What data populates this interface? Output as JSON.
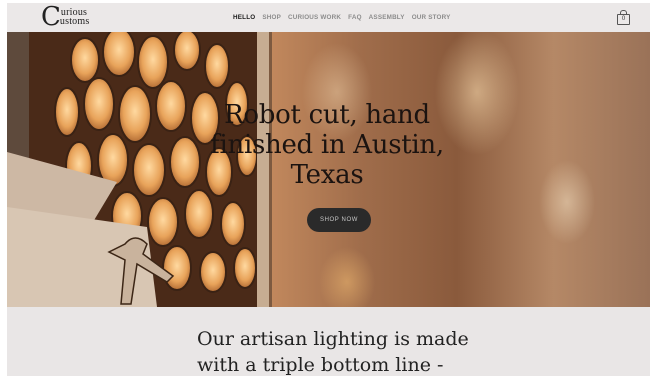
{
  "brand": {
    "logo_initial": "C",
    "logo_line1": "urious",
    "logo_line2": "ustoms"
  },
  "nav": {
    "items": [
      {
        "label": "HELLO",
        "active": true
      },
      {
        "label": "SHOP",
        "active": false
      },
      {
        "label": "CURIOUS WORK",
        "active": false
      },
      {
        "label": "FAQ",
        "active": false
      },
      {
        "label": "ASSEMBLY",
        "active": false
      },
      {
        "label": "OUR STORY",
        "active": false
      }
    ]
  },
  "cart": {
    "count": "0",
    "icon": "shopping-bag-icon"
  },
  "hero": {
    "title_line1": "Robot cut, hand",
    "title_line2": "finished in Austin,",
    "title_line3": "Texas",
    "cta_label": "SHOP NOW"
  },
  "intro": {
    "line1": "Our artisan lighting is made",
    "line2": "with a triple bottom line -"
  },
  "colors": {
    "page_bg": "#e9e6e6",
    "button_bg": "#2a2a2a",
    "active_nav": "#1a1a1a",
    "nav_text": "#8c8c8c"
  }
}
